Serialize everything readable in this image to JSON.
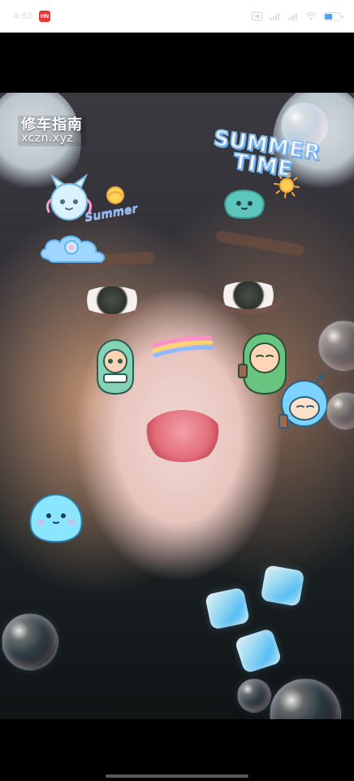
{
  "status_bar": {
    "time": "4:52",
    "notification_badge": "HN",
    "battery_percent": 45
  },
  "watermark": {
    "title": "修车指南",
    "url": "xczn.xyz"
  },
  "stickers": {
    "summer_big_line1": "SUMMER",
    "summer_big_line2": "TIME",
    "summer_small": "Summer"
  }
}
